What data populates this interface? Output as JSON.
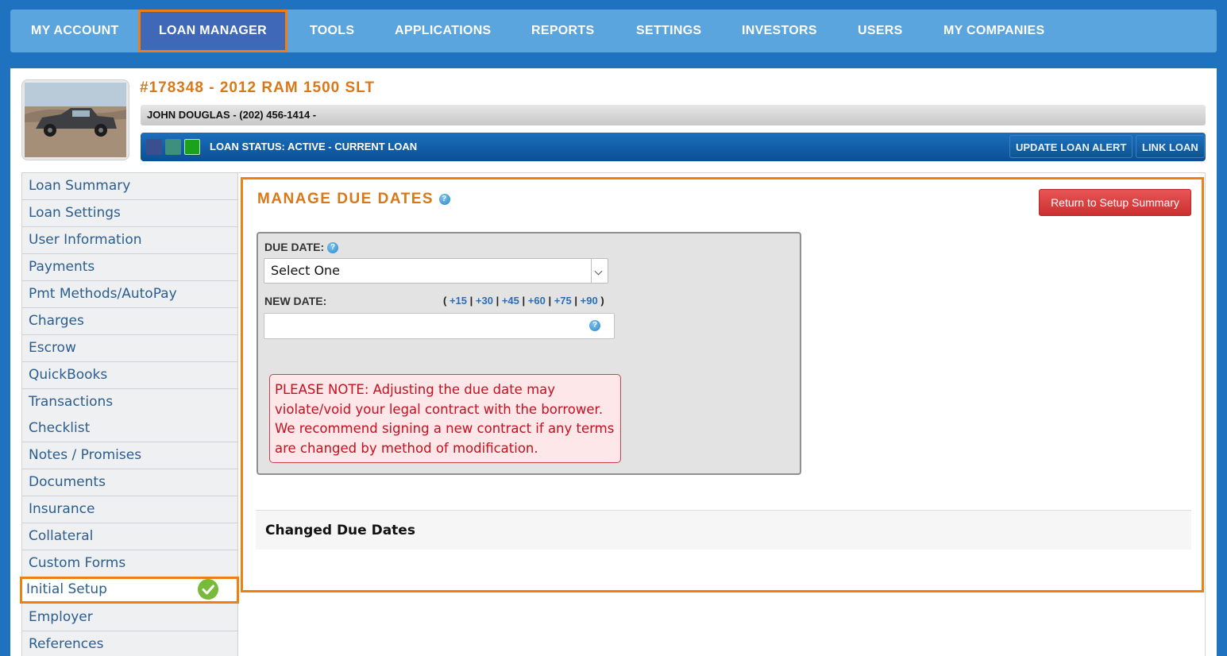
{
  "nav": {
    "items": [
      {
        "label": "MY ACCOUNT"
      },
      {
        "label": "LOAN MANAGER",
        "active": true
      },
      {
        "label": "TOOLS"
      },
      {
        "label": "APPLICATIONS"
      },
      {
        "label": "REPORTS"
      },
      {
        "label": "SETTINGS"
      },
      {
        "label": "INVESTORS"
      },
      {
        "label": "USERS"
      },
      {
        "label": "MY COMPANIES"
      }
    ]
  },
  "loan": {
    "title": "#178348 - 2012 RAM 1500 SLT",
    "borrower": "JOHN DOUGLAS - (202) 456-1414 -",
    "status": "LOAN STATUS: ACTIVE - CURRENT LOAN",
    "update_alert_label": "UPDATE LOAN ALERT",
    "link_loan_label": "LINK LOAN",
    "status_colors": [
      "#3a4f8f",
      "#3f8f7f",
      "#1aa31a"
    ]
  },
  "sidebar": {
    "items": [
      {
        "label": "Loan Summary"
      },
      {
        "label": "Loan Settings"
      },
      {
        "label": "User Information"
      },
      {
        "label": "Payments"
      },
      {
        "label": "Pmt Methods/AutoPay"
      },
      {
        "label": "Charges"
      },
      {
        "label": "Escrow"
      },
      {
        "label": "QuickBooks"
      },
      {
        "label": "Transactions"
      },
      {
        "label": "Checklist"
      },
      {
        "label": "Notes / Promises"
      },
      {
        "label": "Documents"
      },
      {
        "label": "Insurance"
      },
      {
        "label": "Collateral"
      },
      {
        "label": "Custom Forms"
      },
      {
        "label": "Initial Setup",
        "active": true,
        "icon": "check-circle-icon"
      },
      {
        "label": "Employer"
      },
      {
        "label": "References"
      }
    ]
  },
  "panel": {
    "title": "MANAGE DUE DATES",
    "return_label": "Return to Setup Summary",
    "due_date_label": "DUE DATE:",
    "due_date_value": "Select One",
    "new_date_label": "NEW DATE:",
    "quick_add": [
      "+15",
      "+30",
      "+45",
      "+60",
      "+75",
      "+90"
    ],
    "new_date_value": "",
    "note": "PLEASE NOTE: Adjusting the due date may violate/void your legal contract with the borrower. We recommend signing a new contract if any terms are changed by method of modification.",
    "changed_title": "Changed Due Dates"
  },
  "colors": {
    "accent_orange": "#f07f13",
    "nav_bg": "#5aa5dd",
    "page_bg": "#1e72c0",
    "return_red": "#d93a3a"
  }
}
